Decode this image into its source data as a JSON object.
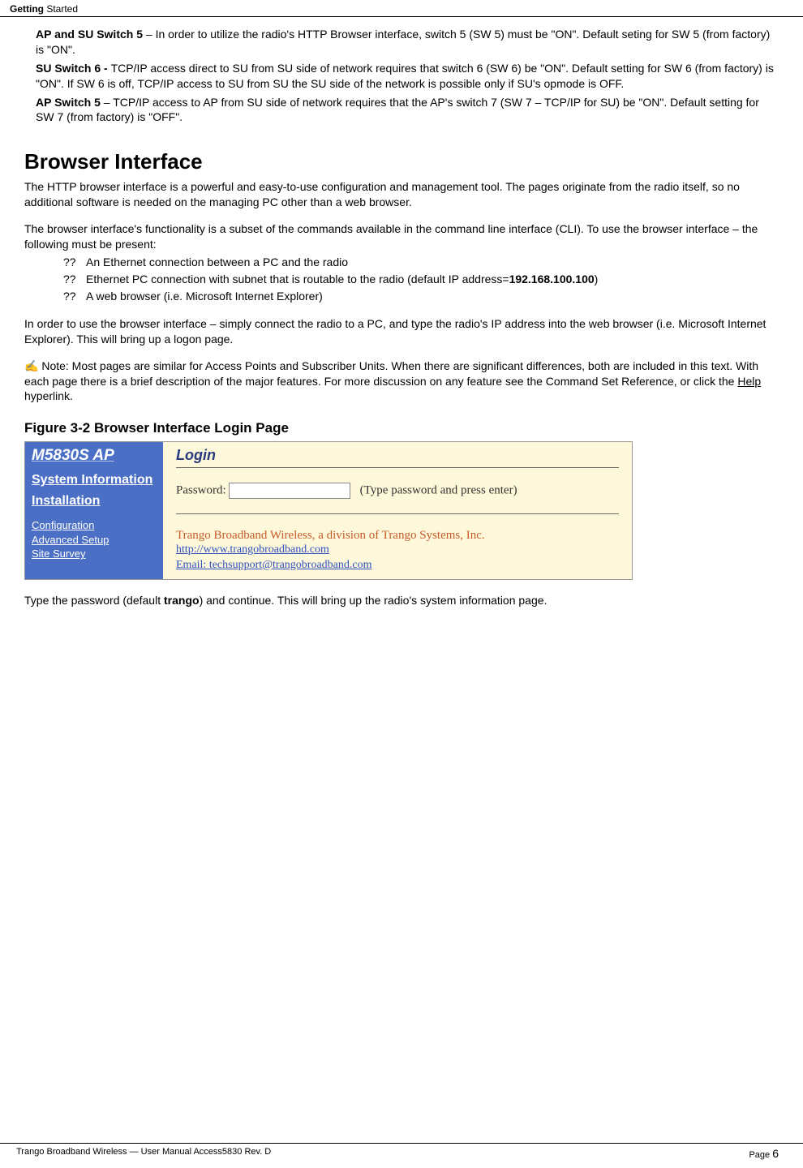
{
  "header": {
    "left_bold": "Getting",
    "left_rest": " Started"
  },
  "switches": {
    "sw5_label": "AP and SU Switch 5",
    "sw5_text": " – In order to utilize the radio's HTTP Browser interface, switch 5 (SW 5) must be \"ON\".  Default seting for SW 5 (from factory) is \"ON\".",
    "sw6_label": "SU Switch 6 - ",
    "sw6_text": "TCP/IP access direct to SU from SU side of network requires that switch 6 (SW 6) be \"ON\".    Default setting for SW 6 (from factory) is \"ON\". If SW 6 is off, TCP/IP access to SU from SU the SU side of the network is possible only if SU's opmode is OFF.",
    "sw7_label": "AP Switch 5",
    "sw7_text": " – TCP/IP access to AP from SU side of network requires that the AP's switch 7 (SW 7 – TCP/IP for SU) be \"ON\".   Default setting for SW 7 (from factory) is \"OFF\"."
  },
  "section": {
    "title": "Browser Interface",
    "intro": "The HTTP browser interface is a powerful and easy-to-use configuration and management tool.    The pages originate from the radio itself, so no additional software is needed on the managing PC other than a web browser.",
    "subset": "The browser interface's functionality is a subset of the commands available in the command line interface (CLI).  To use the browser interface – the following must be present:",
    "bullets": {
      "marker": "??",
      "b1": "An Ethernet connection between a PC and the radio",
      "b2_pre": "Ethernet PC connection with subnet that is routable to the radio (default IP address=",
      "b2_ip": "192.168.100.100",
      "b2_post": ")",
      "b3": "A web browser (i.e. Microsoft Internet Explorer)"
    },
    "inorder": "In order to use the browser interface – simply connect the radio to a PC, and type the radio's IP address into the web browser (i.e. Microsoft Internet Explorer).      This will bring up a logon page.",
    "note_icon": "✍",
    "note_text": "    Note: Most pages are similar for Access Points and Subscriber Units.  When there are significant differences, both are included in this text.  With each page there is a brief description of the major features.  For more discussion on any feature see the Command Set Reference, or click the ",
    "note_help": "Help",
    "note_end": " hyperlink."
  },
  "figure": {
    "title": "Figure 3-2 Browser Interface Login Page",
    "sidebar": {
      "brand": "M5830S AP",
      "sys_info": "System Information",
      "installation": "Installation",
      "config": "Configuration",
      "adv": "Advanced Setup",
      "survey": "Site Survey"
    },
    "main": {
      "heading": "Login",
      "password_label": "Password:",
      "hint": "(Type password and press enter)",
      "company": "Trango Broadband Wireless, a division of Trango Systems, Inc.",
      "link1": "http://www.trangobroadband.com",
      "link2": "Email: techsupport@trangobroadband.com"
    }
  },
  "after_figure_pre": "Type the password (default ",
  "after_figure_bold": "trango",
  "after_figure_post": ") and continue.   This will bring up the radio's system information page.",
  "footer": {
    "left": "Trango Broadband Wireless — User Manual Access5830  Rev. D",
    "right_label": "Page ",
    "right_num": "6"
  }
}
